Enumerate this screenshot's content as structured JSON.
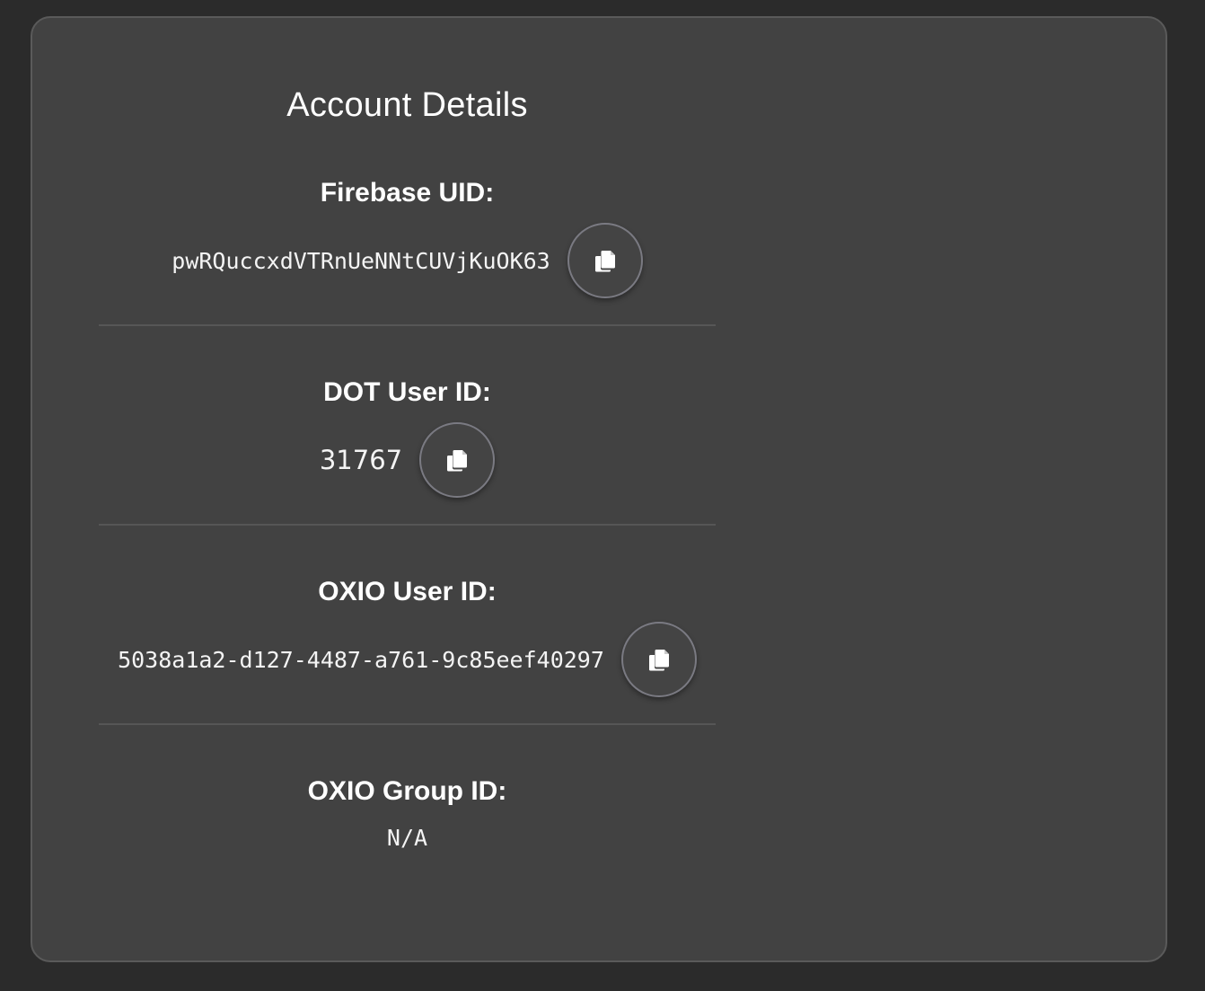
{
  "card": {
    "title": "Account Details"
  },
  "fields": {
    "firebase_uid": {
      "label": "Firebase UID:",
      "value": "pwRQuccxdVTRnUeNNtCUVjKuOK63"
    },
    "dot_user_id": {
      "label": "DOT User ID:",
      "value": "31767"
    },
    "oxio_user_id": {
      "label": "OXIO User ID:",
      "value": "5038a1a2-d127-4487-a761-9c85eef40297"
    },
    "oxio_group_id": {
      "label": "OXIO Group ID:",
      "value": "N/A"
    }
  },
  "icons": {
    "copy": "copy-icon"
  },
  "colors": {
    "page_background": "#2b2b2b",
    "card_background": "#424242",
    "text": "#ffffff"
  }
}
